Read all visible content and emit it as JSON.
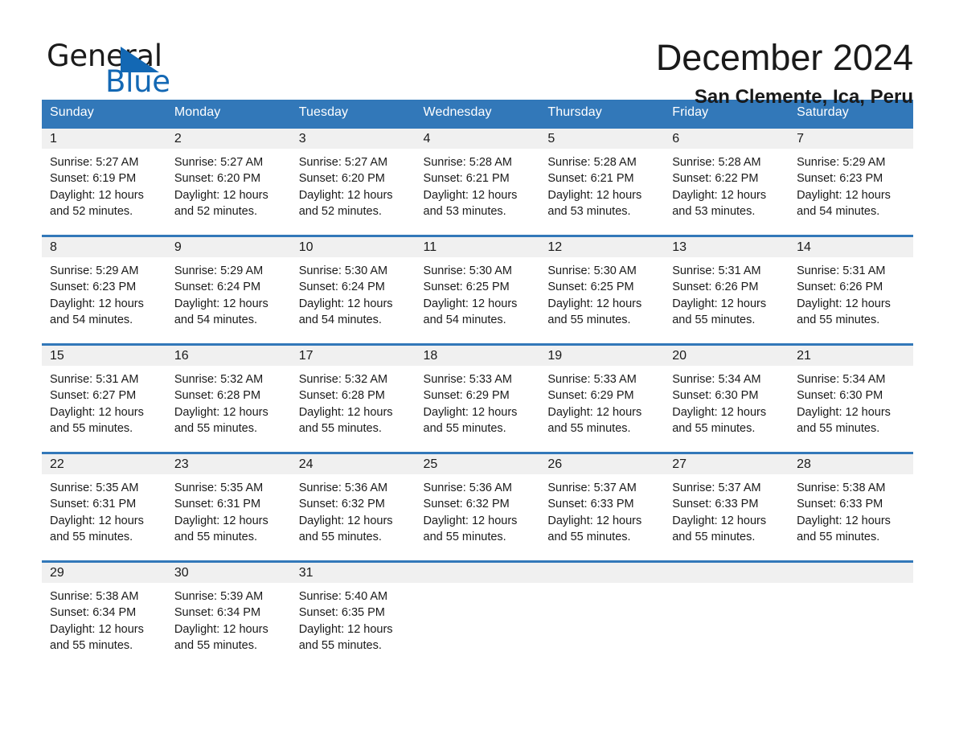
{
  "brand": {
    "name_part1": "General",
    "name_part2": "Blue",
    "logo_icon": "triangle-flag-icon"
  },
  "header": {
    "month_title": "December 2024",
    "location": "San Clemente, Ica, Peru"
  },
  "calendar": {
    "weekday_headers": [
      "Sunday",
      "Monday",
      "Tuesday",
      "Wednesday",
      "Thursday",
      "Friday",
      "Saturday"
    ],
    "accent_color": "#3278b9",
    "date_band_color": "#f0f0f0",
    "weeks": [
      [
        {
          "date": "1",
          "sunrise": "Sunrise: 5:27 AM",
          "sunset": "Sunset: 6:19 PM",
          "daylight": "Daylight: 12 hours and 52 minutes."
        },
        {
          "date": "2",
          "sunrise": "Sunrise: 5:27 AM",
          "sunset": "Sunset: 6:20 PM",
          "daylight": "Daylight: 12 hours and 52 minutes."
        },
        {
          "date": "3",
          "sunrise": "Sunrise: 5:27 AM",
          "sunset": "Sunset: 6:20 PM",
          "daylight": "Daylight: 12 hours and 52 minutes."
        },
        {
          "date": "4",
          "sunrise": "Sunrise: 5:28 AM",
          "sunset": "Sunset: 6:21 PM",
          "daylight": "Daylight: 12 hours and 53 minutes."
        },
        {
          "date": "5",
          "sunrise": "Sunrise: 5:28 AM",
          "sunset": "Sunset: 6:21 PM",
          "daylight": "Daylight: 12 hours and 53 minutes."
        },
        {
          "date": "6",
          "sunrise": "Sunrise: 5:28 AM",
          "sunset": "Sunset: 6:22 PM",
          "daylight": "Daylight: 12 hours and 53 minutes."
        },
        {
          "date": "7",
          "sunrise": "Sunrise: 5:29 AM",
          "sunset": "Sunset: 6:23 PM",
          "daylight": "Daylight: 12 hours and 54 minutes."
        }
      ],
      [
        {
          "date": "8",
          "sunrise": "Sunrise: 5:29 AM",
          "sunset": "Sunset: 6:23 PM",
          "daylight": "Daylight: 12 hours and 54 minutes."
        },
        {
          "date": "9",
          "sunrise": "Sunrise: 5:29 AM",
          "sunset": "Sunset: 6:24 PM",
          "daylight": "Daylight: 12 hours and 54 minutes."
        },
        {
          "date": "10",
          "sunrise": "Sunrise: 5:30 AM",
          "sunset": "Sunset: 6:24 PM",
          "daylight": "Daylight: 12 hours and 54 minutes."
        },
        {
          "date": "11",
          "sunrise": "Sunrise: 5:30 AM",
          "sunset": "Sunset: 6:25 PM",
          "daylight": "Daylight: 12 hours and 54 minutes."
        },
        {
          "date": "12",
          "sunrise": "Sunrise: 5:30 AM",
          "sunset": "Sunset: 6:25 PM",
          "daylight": "Daylight: 12 hours and 55 minutes."
        },
        {
          "date": "13",
          "sunrise": "Sunrise: 5:31 AM",
          "sunset": "Sunset: 6:26 PM",
          "daylight": "Daylight: 12 hours and 55 minutes."
        },
        {
          "date": "14",
          "sunrise": "Sunrise: 5:31 AM",
          "sunset": "Sunset: 6:26 PM",
          "daylight": "Daylight: 12 hours and 55 minutes."
        }
      ],
      [
        {
          "date": "15",
          "sunrise": "Sunrise: 5:31 AM",
          "sunset": "Sunset: 6:27 PM",
          "daylight": "Daylight: 12 hours and 55 minutes."
        },
        {
          "date": "16",
          "sunrise": "Sunrise: 5:32 AM",
          "sunset": "Sunset: 6:28 PM",
          "daylight": "Daylight: 12 hours and 55 minutes."
        },
        {
          "date": "17",
          "sunrise": "Sunrise: 5:32 AM",
          "sunset": "Sunset: 6:28 PM",
          "daylight": "Daylight: 12 hours and 55 minutes."
        },
        {
          "date": "18",
          "sunrise": "Sunrise: 5:33 AM",
          "sunset": "Sunset: 6:29 PM",
          "daylight": "Daylight: 12 hours and 55 minutes."
        },
        {
          "date": "19",
          "sunrise": "Sunrise: 5:33 AM",
          "sunset": "Sunset: 6:29 PM",
          "daylight": "Daylight: 12 hours and 55 minutes."
        },
        {
          "date": "20",
          "sunrise": "Sunrise: 5:34 AM",
          "sunset": "Sunset: 6:30 PM",
          "daylight": "Daylight: 12 hours and 55 minutes."
        },
        {
          "date": "21",
          "sunrise": "Sunrise: 5:34 AM",
          "sunset": "Sunset: 6:30 PM",
          "daylight": "Daylight: 12 hours and 55 minutes."
        }
      ],
      [
        {
          "date": "22",
          "sunrise": "Sunrise: 5:35 AM",
          "sunset": "Sunset: 6:31 PM",
          "daylight": "Daylight: 12 hours and 55 minutes."
        },
        {
          "date": "23",
          "sunrise": "Sunrise: 5:35 AM",
          "sunset": "Sunset: 6:31 PM",
          "daylight": "Daylight: 12 hours and 55 minutes."
        },
        {
          "date": "24",
          "sunrise": "Sunrise: 5:36 AM",
          "sunset": "Sunset: 6:32 PM",
          "daylight": "Daylight: 12 hours and 55 minutes."
        },
        {
          "date": "25",
          "sunrise": "Sunrise: 5:36 AM",
          "sunset": "Sunset: 6:32 PM",
          "daylight": "Daylight: 12 hours and 55 minutes."
        },
        {
          "date": "26",
          "sunrise": "Sunrise: 5:37 AM",
          "sunset": "Sunset: 6:33 PM",
          "daylight": "Daylight: 12 hours and 55 minutes."
        },
        {
          "date": "27",
          "sunrise": "Sunrise: 5:37 AM",
          "sunset": "Sunset: 6:33 PM",
          "daylight": "Daylight: 12 hours and 55 minutes."
        },
        {
          "date": "28",
          "sunrise": "Sunrise: 5:38 AM",
          "sunset": "Sunset: 6:33 PM",
          "daylight": "Daylight: 12 hours and 55 minutes."
        }
      ],
      [
        {
          "date": "29",
          "sunrise": "Sunrise: 5:38 AM",
          "sunset": "Sunset: 6:34 PM",
          "daylight": "Daylight: 12 hours and 55 minutes."
        },
        {
          "date": "30",
          "sunrise": "Sunrise: 5:39 AM",
          "sunset": "Sunset: 6:34 PM",
          "daylight": "Daylight: 12 hours and 55 minutes."
        },
        {
          "date": "31",
          "sunrise": "Sunrise: 5:40 AM",
          "sunset": "Sunset: 6:35 PM",
          "daylight": "Daylight: 12 hours and 55 minutes."
        },
        {
          "date": "",
          "sunrise": "",
          "sunset": "",
          "daylight": ""
        },
        {
          "date": "",
          "sunrise": "",
          "sunset": "",
          "daylight": ""
        },
        {
          "date": "",
          "sunrise": "",
          "sunset": "",
          "daylight": ""
        },
        {
          "date": "",
          "sunrise": "",
          "sunset": "",
          "daylight": ""
        }
      ]
    ]
  }
}
